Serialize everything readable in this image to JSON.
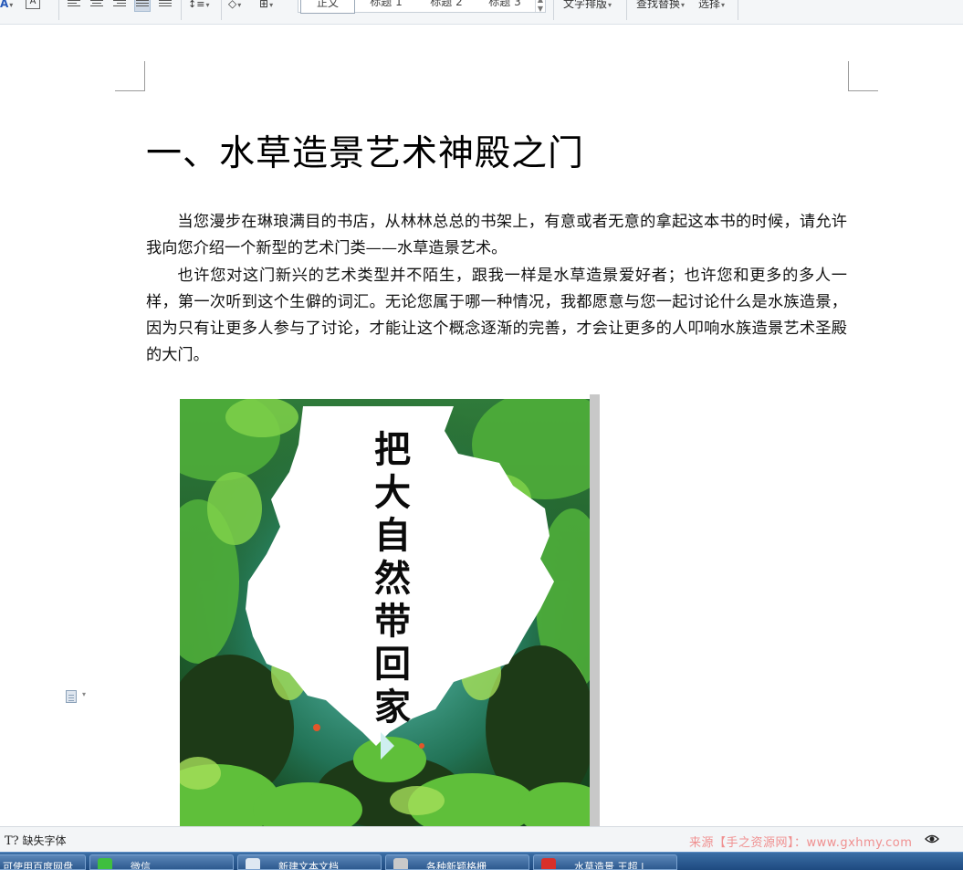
{
  "ribbon": {
    "styles": [
      "正文",
      "标题 1",
      "标题 2",
      "标题 3"
    ],
    "text_layout_label": "文字排版",
    "find_replace_label": "查找替换",
    "select_label": "选择"
  },
  "document": {
    "heading": "一、水草造景艺术神殿之门",
    "paragraphs": [
      "当您漫步在琳琅满目的书店，从林林总总的书架上，有意或者无意的拿起这本书的时候，请允许我向您介绍一个新型的艺术门类——水草造景艺术。",
      "也许您对这门新兴的艺术类型并不陌生，跟我一样是水草造景爱好者；也许您和更多的多人一样，第一次听到这个生僻的词汇。无论您属于哪一种情况，我都愿意与您一起讨论什么是水族造景，因为只有让更多人参与了讨论，才能让这个概念逐渐的完善，才会让更多的人叩响水族造景艺术圣殿的大门。"
    ],
    "figure_title_chars": [
      "把",
      "大",
      "自",
      "然",
      "带",
      "回",
      "家"
    ]
  },
  "statusbar": {
    "missing_font_label": "缺失字体",
    "watermark": "来源【手之资源网】：www.gxhmy.com"
  },
  "taskbar": {
    "items": [
      "可使用百度网盘",
      "微信",
      "新建文本文档",
      "各种新颖格栅",
      "水草造景 王超 |"
    ]
  }
}
